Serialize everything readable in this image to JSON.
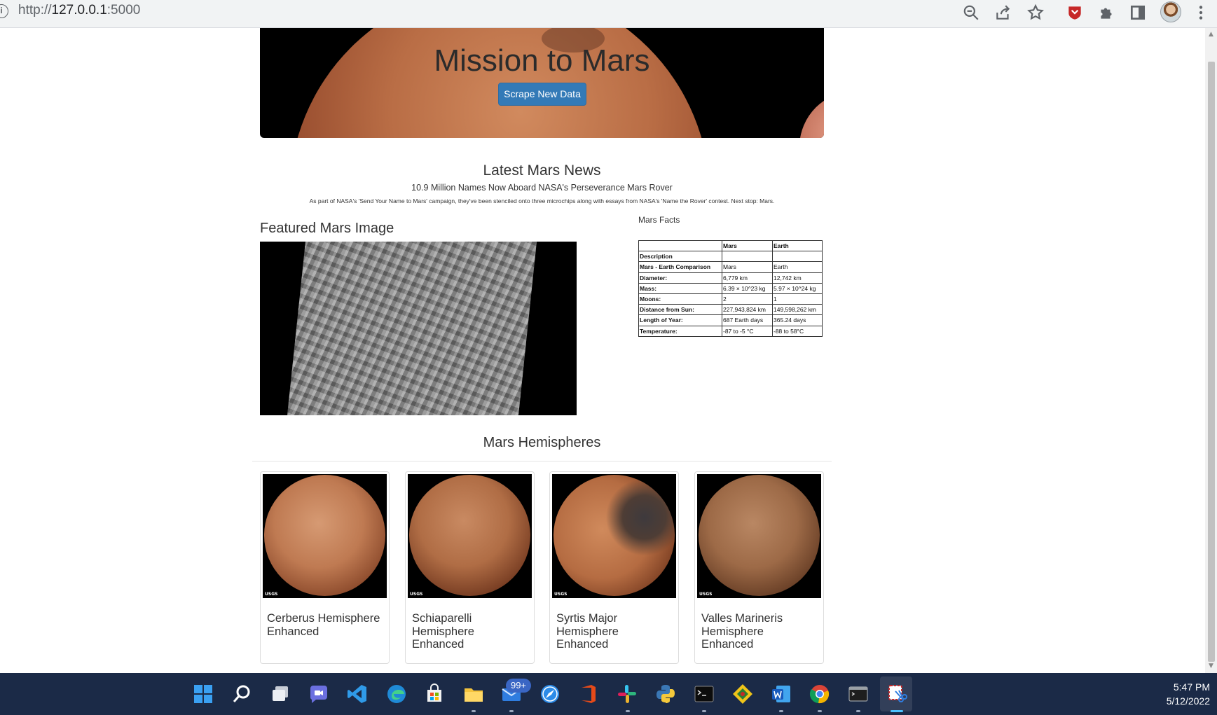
{
  "browser": {
    "url_scheme": "http://",
    "url_host": "127.0.0.1",
    "url_port": ":5000",
    "toolbar_icons": [
      "zoom-out-icon",
      "share-icon",
      "bookmark-star-icon",
      "extension-shield-icon",
      "extensions-puzzle-icon",
      "side-panel-icon",
      "profile-avatar",
      "more-menu-icon"
    ]
  },
  "jumbotron": {
    "title": "Mission to Mars",
    "button_label": "Scrape New Data",
    "button_color": "#337ab7"
  },
  "news": {
    "heading": "Latest Mars News",
    "title": "10.9 Million Names Now Aboard NASA's Perseverance Mars Rover",
    "paragraph": "As part of NASA's 'Send Your Name to Mars' campaign, they've been stenciled onto three microchips along with essays from NASA's 'Name the Rover' contest. Next stop: Mars."
  },
  "featured": {
    "heading": "Featured Mars Image"
  },
  "facts": {
    "heading": "Mars Facts",
    "columns": [
      "",
      "Mars",
      "Earth"
    ],
    "rows": [
      [
        "Description",
        "",
        ""
      ],
      [
        "Mars - Earth Comparison",
        "Mars",
        "Earth"
      ],
      [
        "Diameter:",
        "6,779 km",
        "12,742 km"
      ],
      [
        "Mass:",
        "6.39 × 10^23 kg",
        "5.97 × 10^24 kg"
      ],
      [
        "Moons:",
        "2",
        "1"
      ],
      [
        "Distance from Sun:",
        "227,943,824 km",
        "149,598,262 km"
      ],
      [
        "Length of Year:",
        "687 Earth days",
        "365.24 days"
      ],
      [
        "Temperature:",
        "-87 to -5 °C",
        "-88 to 58°C"
      ]
    ]
  },
  "hemispheres": {
    "heading": "Mars Hemispheres",
    "items": [
      {
        "title": "Cerberus Hemisphere Enhanced",
        "logo": "USGS"
      },
      {
        "title": "Schiaparelli Hemisphere Enhanced",
        "logo": "USGS"
      },
      {
        "title": "Syrtis Major Hemisphere Enhanced",
        "logo": "USGS"
      },
      {
        "title": "Valles Marineris Hemisphere Enhanced",
        "logo": "USGS"
      }
    ]
  },
  "taskbar": {
    "icons": [
      "windows-start-icon",
      "search-icon",
      "task-view-icon",
      "teams-chat-icon",
      "vscode-icon",
      "edge-icon",
      "store-icon",
      "file-explorer-icon",
      "mail-icon",
      "safari-icon",
      "office-icon",
      "slack-icon",
      "python-icon",
      "terminal-icon",
      "git-icon",
      "word-icon",
      "chrome-icon",
      "command-prompt-icon",
      "snipping-tool-icon"
    ],
    "mail_badge": "99+",
    "time": "5:47 PM",
    "date": "5/12/2022"
  }
}
